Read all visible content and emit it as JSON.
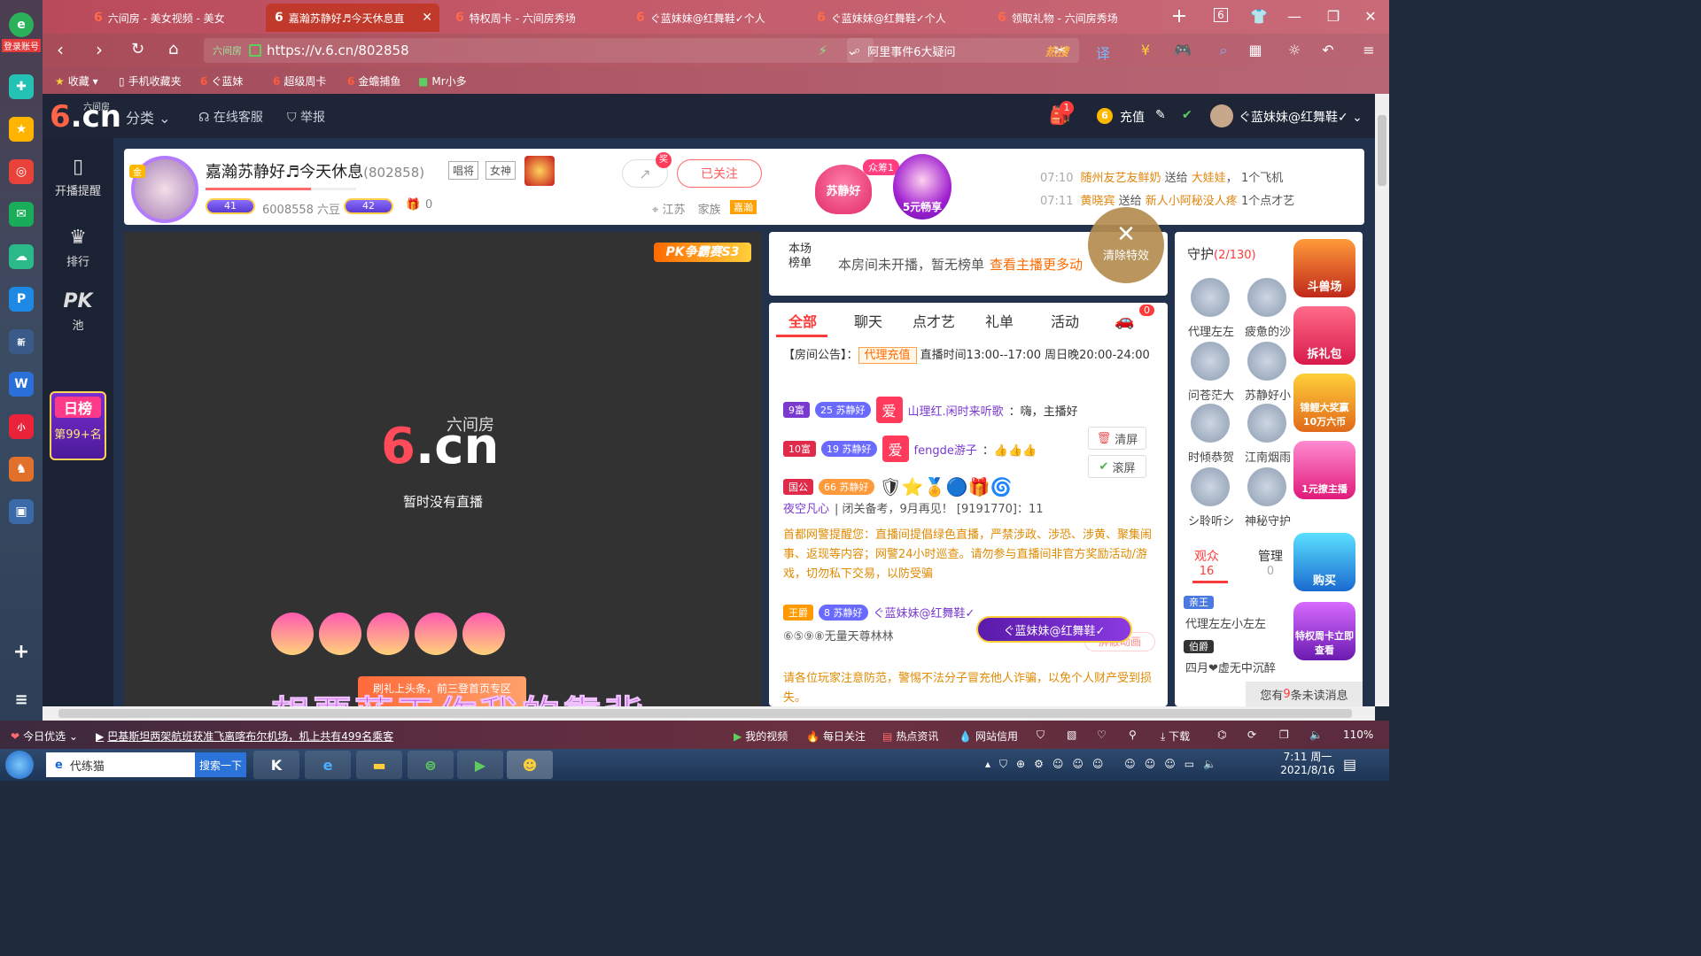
{
  "browser": {
    "tabs": [
      {
        "label": "六间房 - 美女视频 - 美女",
        "active": false
      },
      {
        "label": "嘉瀚苏静好♬今天休息直",
        "active": true
      },
      {
        "label": "特权周卡 - 六间房秀场",
        "active": false
      },
      {
        "label": "ぐ蓝妹妹@红舞鞋✓个人",
        "active": false
      },
      {
        "label": "ぐ蓝妹妹@红舞鞋✓个人",
        "active": false
      },
      {
        "label": "领取礼物 - 六间房秀场",
        "active": false
      }
    ],
    "tab_count": "6",
    "url": "https://v.6.cn/802858",
    "url_pill": "六间房",
    "search_text": "阿里事件6大疑问",
    "search_hot": "热搜",
    "bookmarks": [
      {
        "label": "收藏",
        "icon": "star-icon"
      },
      {
        "label": "手机收藏夹",
        "icon": "phone-icon"
      },
      {
        "label": "ぐ蓝妹",
        "icon": "6cn-icon"
      },
      {
        "label": "超级周卡",
        "icon": "6cn-icon"
      },
      {
        "label": "金蟾捕鱼",
        "icon": "6cn-icon"
      },
      {
        "label": "Mr小多",
        "icon": "app-icon"
      }
    ]
  },
  "leftrail": {
    "login_label": "登录账号"
  },
  "site": {
    "logo_small": "六间房",
    "logo_text": ".cn",
    "nav": [
      "分类",
      "在线客服",
      "举报"
    ],
    "user": {
      "notify_count": "1",
      "recharge_label": "充值",
      "username": "ぐ蓝妹妹@红舞鞋✓"
    },
    "leftnav": [
      {
        "label": "开播提醒",
        "icon": "phone-icon"
      },
      {
        "label": "排行",
        "icon": "crown-icon"
      },
      {
        "label": "池",
        "icon": "pk-icon",
        "big": "PK"
      }
    ],
    "daily_rank": {
      "title": "日榜",
      "rank": "第99+名"
    }
  },
  "anchor": {
    "gold_tag": "金",
    "name": "嘉瀚苏静好♬今天休息",
    "room_id": "(802858)",
    "tags": [
      "唱将",
      "女神"
    ],
    "level_a": "41",
    "level_b": "42",
    "beans": "6008558 六豆",
    "gift_count": "0",
    "follow_label": "已关注",
    "location": "江苏",
    "family_label": "家族",
    "family_tag": "嘉瀚",
    "heart_label": "苏静好",
    "crowd_tag": "众筹1",
    "five_label": "5元畅享",
    "feed": [
      {
        "time": "07:10",
        "user": "随州友艺友鲜奶",
        "verb": "送给",
        "target": "大娃娃",
        "gift": "1个飞机"
      },
      {
        "time": "07:11",
        "user": "黄晓宾",
        "verb": "送给",
        "target": "新人小阿秘没人疼",
        "gift": "1个点才艺"
      }
    ]
  },
  "video": {
    "pk_badge": "PK争霸赛S3",
    "logo_small": "六间房",
    "logo_text": ".cn",
    "empty_text": "暂时没有直播",
    "banner": "刷礼上头条，前三登首页专区"
  },
  "rankboard": {
    "label": "本场榜单",
    "message": "本房间未开播，暂无榜单",
    "link": "查看主播更多动",
    "clear_fx": "清除特效"
  },
  "chat": {
    "tabs": [
      "全部",
      "聊天",
      "点才艺",
      "礼单",
      "活动"
    ],
    "car_count": "0",
    "notice_prefix": "【房间公告】：",
    "notice_pill": "代理充值",
    "notice_text": "直播时间13:00--17:00 周日晚20:00-24:00",
    "messages": [
      {
        "rank": "9富",
        "level": "25",
        "fan": "苏静好",
        "user": "山理红.闲时来听歌",
        "text": "：嗨，主播好"
      },
      {
        "rank": "10富",
        "level": "19",
        "fan": "苏静好",
        "user": "fengde游子",
        "text": "：👍👍👍"
      },
      {
        "rank": "国公",
        "level": "66",
        "fan": "苏静好",
        "user": "夜空凡心",
        "text": "| 闭关备考，9月再见！ [9191770]：11"
      }
    ],
    "clear_label": "清屏",
    "scroll_label": "滚屏",
    "system_notice": "首都网警提醒您：直播间提倡绿色直播，严禁涉政、涉恐、涉黄、聚集闹事、返现等内容；网警24小时巡查。请勿参与直播间非官方奖励活动/游戏，切勿私下交易，以防受骗",
    "last_msg": {
      "rank": "王爵",
      "level": "8",
      "fan": "苏静好",
      "user": "ぐ蓝妹妹@红舞鞋✓",
      "sub": "⑥⑤⑨⑧无量天尊林林"
    },
    "block_anim": "屏蔽动画",
    "warning": "请各位玩家注意防范，警惕不法分子冒充他人诈骗，以免个人财产受到损失。"
  },
  "guard": {
    "title": "守护",
    "count": "(2/130)",
    "members": [
      "代理左左",
      "疲惫的沙",
      "问苍茫大",
      "苏静好小",
      "时倾恭贺",
      "江南烟雨",
      "シ聆听シ",
      "神秘守护"
    ],
    "tabs": [
      {
        "label": "观众",
        "count": "16"
      },
      {
        "label": "管理",
        "count": "0"
      }
    ],
    "viewers": [
      {
        "rank": "亲王",
        "name": "代理左左小左左"
      },
      {
        "rank": "伯爵",
        "name": "四月❤虚无中沉醉"
      }
    ],
    "unread_prefix": "您有",
    "unread_count": "9",
    "unread_suffix": "条未读消息"
  },
  "promos": [
    "斗兽场",
    "拆礼包",
    "锦鲤大奖赢10万六币",
    "1元撩主播",
    "购买",
    "特权周卡立即查看"
  ],
  "float_tag": "ぐ蓝妹妹@红舞鞋✓",
  "lyrics": "想要蓝天作我的靠背",
  "statusbar": {
    "today": "今日优选",
    "news": "巴基斯坦两架航班获准飞离喀布尔机场，机上共有499名乘客",
    "items": [
      "我的视频",
      "每日关注",
      "热点资讯",
      "网站信用"
    ],
    "download": "下载",
    "zoom": "110%"
  },
  "taskbar": {
    "search_text": "代练猫",
    "search_btn": "搜索一下",
    "time": "7:11 周一",
    "date": "2021/8/16"
  }
}
